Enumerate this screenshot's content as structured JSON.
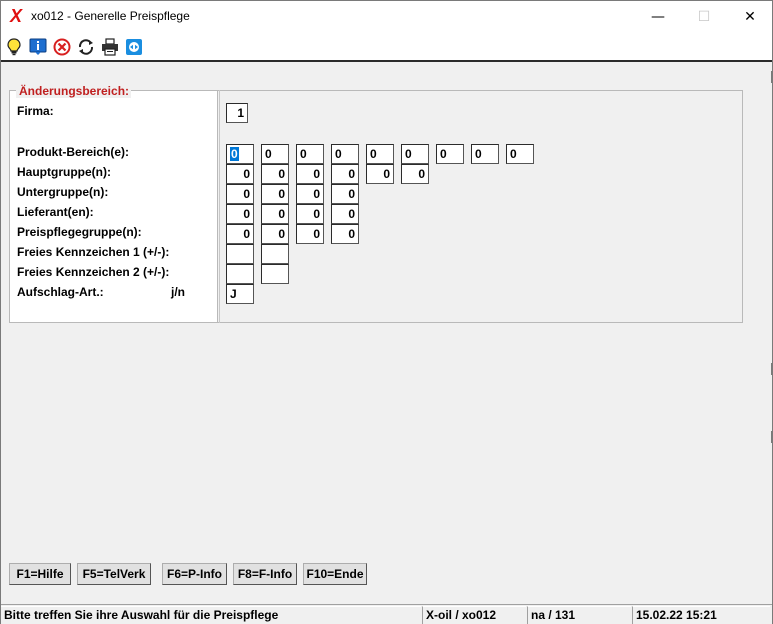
{
  "window": {
    "logo": "X",
    "title": "xo012 - Generelle Preispflege",
    "minimize": "—",
    "maximize": "☐",
    "close": "✕"
  },
  "toolbar": {
    "icons": [
      "lightbulb-icon",
      "info-icon",
      "cancel-icon",
      "refresh-icon",
      "printer-icon",
      "remote-icon"
    ],
    "colors": {
      "info": "#1e6fd0",
      "cancel": "#d82020",
      "remote": "#1a8ee0"
    }
  },
  "group": {
    "legend": "Änderungsbereich:",
    "labels": {
      "firma": "Firma:",
      "produkt": "Produkt-Bereich(e):",
      "hauptgruppe": "Hauptgruppe(n):",
      "untergruppe": "Untergruppe(n):",
      "lieferant": "Lieferant(en):",
      "preispflegegruppe": "Preispflegegruppe(n):",
      "kz1": "Freies Kennzeichen 1 (+/-):",
      "kz2": "Freies Kennzeichen 2 (+/-):",
      "aufschlag": "Aufschlag-Art.:",
      "jn": "j/n"
    }
  },
  "fields": {
    "firma": "1",
    "produkt": [
      "0",
      "0",
      "0",
      "0",
      "0",
      "0",
      "0",
      "0",
      "0"
    ],
    "hauptgruppe": [
      "0",
      "0",
      "0",
      "0",
      "0",
      "0"
    ],
    "untergruppe": [
      "0",
      "0",
      "0",
      "0"
    ],
    "lieferant": [
      "0",
      "0",
      "0",
      "0"
    ],
    "preispflegegruppe": [
      "0",
      "0",
      "0",
      "0"
    ],
    "kz1": [
      "",
      ""
    ],
    "kz2": [
      "",
      ""
    ],
    "aufschlag": "J"
  },
  "fkeys": [
    "F1=Hilfe",
    "F5=TelVerk",
    "F6=P-Info",
    "F8=F-Info",
    "F10=Ende"
  ],
  "status": {
    "message": "Bitte treffen Sie ihre Auswahl für die Preispflege",
    "program": "X-oil / xo012",
    "user": "na / 131",
    "datetime": "15.02.22 15:21"
  }
}
